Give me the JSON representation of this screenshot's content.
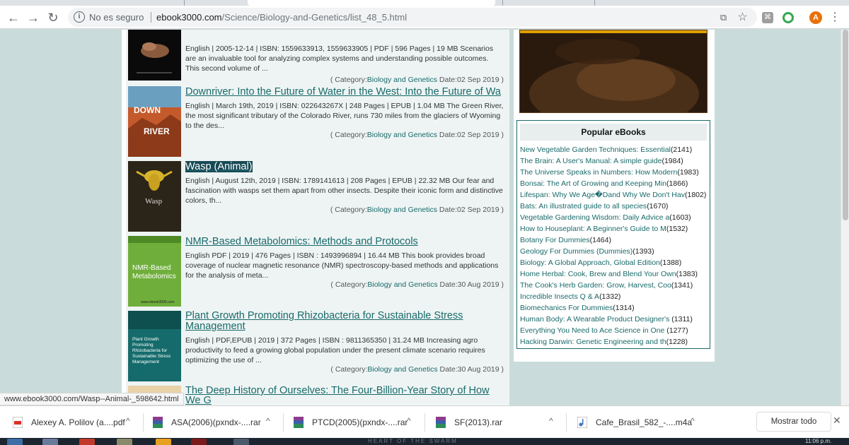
{
  "browser": {
    "security_label": "No es seguro",
    "url_host": "ebook3000.com",
    "url_path": "/Science/Biology-and-Genetics/list_48_5.html",
    "avatar_initial": "A",
    "back_glyph": "←",
    "forward_glyph": "→",
    "reload_glyph": "↻",
    "info_glyph": "i",
    "star_glyph": "☆",
    "translate_glyph": "⧉",
    "menu_glyph": "⋮",
    "icons": [
      "back-arrow-icon",
      "forward-arrow-icon",
      "reload-icon",
      "info-icon",
      "translate-icon",
      "star-icon",
      "pdf-extension-icon",
      "chrome-extension-icon",
      "avatar",
      "menu-icon"
    ]
  },
  "books": [
    {
      "title": "",
      "desc": "English | 2005-12-14 | ISBN: 1559633913, 1559633905 | PDF | 596 Pages | 19 MB Scenarios are an invaluable tool for analyzing complex systems and understanding possible outcomes. This second volume of ...",
      "category_prefix": "( Category:",
      "category": "Biology and Genetics",
      "date": " Date:02 Sep 2019 )"
    },
    {
      "title": "Downriver: Into the Future of Water in the West: Into the Future of Wa",
      "desc": "English | March 19th, 2019 | ISBN: 022643267X | 248 Pages | EPUB | 1.04 MB The Green River, the most significant tributary of the Colorado River, runs 730 miles from the glaciers of Wyoming to the des...",
      "category_prefix": "( Category:",
      "category": "Biology and Genetics",
      "date": " Date:02 Sep 2019 )",
      "cover_text": [
        "DOWN",
        "RIVER"
      ]
    },
    {
      "title": "Wasp (Animal)",
      "desc": "English | August 12th, 2019 | ISBN: 1789141613 | 208 Pages | EPUB | 22.32 MB Our fear and fascination with wasps set them apart from other insects. Despite their iconic form and distinctive colors, th...",
      "category_prefix": "( Category:",
      "category": "Biology and Genetics",
      "date": " Date:02 Sep 2019 )",
      "cover_text": [
        "Wasp"
      ]
    },
    {
      "title": "NMR-Based Metabolomics: Methods and Protocols",
      "desc": "English PDF | 2019 | 476 Pages | ISBN : 1493996894 | 16.44 MB This book provides broad coverage of nuclear magnetic resonance (NMR) spectroscopy-based methods and applications for the analysis of meta...",
      "category_prefix": "( Category:",
      "category": "Biology and Genetics",
      "date": " Date:30 Aug 2019 )",
      "cover_text": [
        "NMR-Based",
        "Metabolomics",
        "www.ebook3000.com"
      ]
    },
    {
      "title": "Plant Growth Promoting Rhizobacteria for Sustainable Stress Management",
      "desc": "English | PDF,EPUB | 2019 | 372 Pages | ISBN : 9811365350 | 31.24 MB Increasing agro productivity to feed a growing global population under the present climate scenario requires optimizing the use of ...",
      "category_prefix": "( Category:",
      "category": "Biology and Genetics",
      "date": " Date:30 Aug 2019 )",
      "cover_text": [
        "Plant Growth",
        "Promoting",
        "Rhizobacteria for",
        "Sustainable Stress",
        "Management"
      ]
    },
    {
      "title": "The Deep History of Ourselves: The Four-Billion-Year Story of How We G",
      "desc": "",
      "category_prefix": "",
      "category": "",
      "date": ""
    }
  ],
  "popular": {
    "heading": "Popular eBooks",
    "items": [
      {
        "title": "New Vegetable Garden Techniques: Essential",
        "count": "(2141)"
      },
      {
        "title": "The Brain: A User's Manual: A simple guide",
        "count": "(1984)"
      },
      {
        "title": "The Universe Speaks in Numbers: How Modern",
        "count": "(1983)"
      },
      {
        "title": "Bonsai: The Art of Growing and Keeping Min",
        "count": "(1866)"
      },
      {
        "title": "Lifespan: Why We Age�Dand Why We Don't Hav",
        "count": "(1802)"
      },
      {
        "title": "Bats: An illustrated guide to all species",
        "count": "(1670)"
      },
      {
        "title": "Vegetable Gardening Wisdom: Daily Advice a",
        "count": "(1603)"
      },
      {
        "title": "How to Houseplant: A Beginner's Guide to M",
        "count": "(1532)"
      },
      {
        "title": "Botany For Dummies",
        "count": "(1464)"
      },
      {
        "title": "Geology For Dummies (Dummies)",
        "count": "(1393)"
      },
      {
        "title": "Biology: A Global Approach, Global Edition",
        "count": "(1388)"
      },
      {
        "title": "Home Herbal: Cook, Brew and Blend Your Own",
        "count": "(1383)"
      },
      {
        "title": "The Cook's Herb Garden: Grow, Harvest, Coo",
        "count": "(1341)"
      },
      {
        "title": "Incredible Insects Q & A",
        "count": "(1332)"
      },
      {
        "title": "Biomechanics For Dummies",
        "count": "(1314)"
      },
      {
        "title": "Human Body: A Wearable Product Designer's ",
        "count": "(1311)"
      },
      {
        "title": "Everything You Need to Ace Science in One ",
        "count": "(1277)"
      },
      {
        "title": "Hacking Darwin: Genetic Engineering and th",
        "count": "(1228)"
      }
    ]
  },
  "status_url": "www.ebook3000.com/Wasp--Animal-_598642.html",
  "downloads": {
    "items": [
      {
        "name": "Alexey A. Polilov (a....pdf",
        "icon": "pdf-file-icon",
        "color": "#d93025"
      },
      {
        "name": "ASA(2006)(pxndx-....rar",
        "icon": "rar-file-icon",
        "color": "#8e3b8e"
      },
      {
        "name": "PTCD(2005)(pxndx-....rar",
        "icon": "rar-file-icon",
        "color": "#8e3b8e"
      },
      {
        "name": "SF(2013).rar",
        "icon": "rar-file-icon",
        "color": "#8e3b8e"
      },
      {
        "name": "Cafe_Brasil_582_-....m4a",
        "icon": "audio-file-icon",
        "color": "#3b78c3"
      }
    ],
    "caret": "^",
    "show_all": "Mostrar todo",
    "close": "✕"
  },
  "taskbar": {
    "banner": "HEART OF THE SWARM",
    "clock": "11:06 p.m."
  },
  "colors": {
    "page_bg": "#c9dcdb",
    "link": "#1a6a6a",
    "highlight": "#174a55",
    "avatar": "#e8710a"
  }
}
